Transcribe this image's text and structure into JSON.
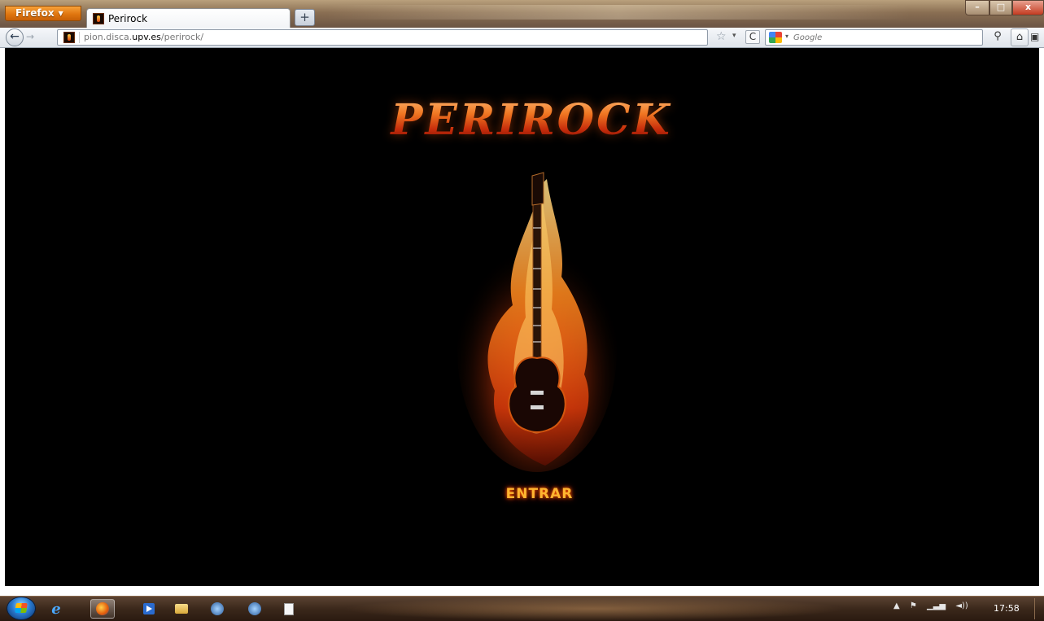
{
  "browser": {
    "menu_button_label": "Firefox",
    "menu_button_arrow": "▼",
    "tab_title": "Perirock",
    "new_tab_label": "+",
    "window_controls": {
      "minimize": "–",
      "maximize": "□",
      "close": "x"
    }
  },
  "navigation": {
    "back_icon": "←",
    "forward_icon": "→",
    "url_prefix": "pion.disca.",
    "url_domain": "upv.es",
    "url_path": "/perirock/",
    "bookmark_star": "☆",
    "dropdown_arrow": "▾",
    "reload_icon": "C",
    "search_engine_arrow": "▾",
    "search_placeholder": "Google",
    "search_icon": "⚲",
    "home_icon": "⌂",
    "addon_icon": "▣"
  },
  "page": {
    "logo_text": "PERIROCK",
    "enter_label": "ENTRAR"
  },
  "taskbar": {
    "ie_glyph": "e",
    "tray_icons": [
      "▲",
      "⚑",
      "▁▃▅",
      "◄))"
    ],
    "clock_time": "17:58"
  },
  "colors": {
    "page_background": "#000000",
    "fire_orange": "#f07722",
    "fire_red": "#c62c0b",
    "enter_text": "#ffb530",
    "firefox_button": "#e07610"
  },
  "icons": {
    "favicon": "perirock-favicon",
    "start": "windows-start-orb",
    "taskbar_apps": [
      "internet-explorer-icon",
      "firefox-icon",
      "media-player-icon",
      "file-explorer-icon",
      "app-icon",
      "app-icon-2",
      "document-icon"
    ]
  }
}
